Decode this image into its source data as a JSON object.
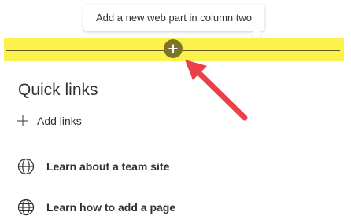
{
  "tooltip": {
    "text": "Add a new web part in column two"
  },
  "add_webpart_button": {
    "icon": "plus-circle-icon",
    "highlight_color": "#fbf24d",
    "button_color": "#7d7524"
  },
  "annotation": {
    "arrow_color": "#e8414a"
  },
  "quick_links": {
    "title": "Quick links",
    "add_links_label": "Add links",
    "items": [
      {
        "label": "Learn about a team site",
        "icon": "globe-icon"
      },
      {
        "label": "Learn how to add a page",
        "icon": "globe-icon"
      }
    ]
  }
}
